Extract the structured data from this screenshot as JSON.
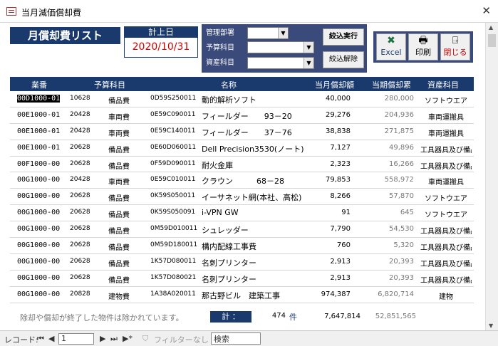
{
  "window": {
    "title": "当月減価償却費"
  },
  "header": {
    "list_title": "月償却費リスト",
    "date_label": "計上日",
    "date_value": "2020/10/31"
  },
  "filters": {
    "dept_label": "管理部署",
    "budget_label": "予算科目",
    "asset_label": "資産科目",
    "apply_label": "絞込実行",
    "clear_label": "絞込解除"
  },
  "actions": {
    "excel_label": "Excel",
    "print_label": "印刷",
    "close_label": "閉じる"
  },
  "columns": {
    "id": "業番",
    "budget": "予算科目",
    "name": "名称",
    "monthly_dep": "当月償却額",
    "cumulative": "当期償却累",
    "asset_category": "資産科目"
  },
  "rows": [
    {
      "id": "00D1000-01",
      "code": "10628",
      "budget": "備品費",
      "asset_no": "0D59S250011",
      "name": "動的解析ソフト",
      "dep": "40,000",
      "cum": "280,000",
      "cat": "ソフトウエア"
    },
    {
      "id": "00E1000-01",
      "code": "20428",
      "budget": "車両費",
      "asset_no": "0E59C090011",
      "name": "フィールダー　　93－20",
      "dep": "29,276",
      "cum": "204,936",
      "cat": "車両運搬具"
    },
    {
      "id": "00E1000-01",
      "code": "20428",
      "budget": "車両費",
      "asset_no": "0E59C140011",
      "name": "フィールダー　　37－76",
      "dep": "38,838",
      "cum": "271,875",
      "cat": "車両運搬具"
    },
    {
      "id": "00E1000-01",
      "code": "20628",
      "budget": "備品費",
      "asset_no": "0E60D060011",
      "name": "Dell Precision3530(ノート)",
      "dep": "7,127",
      "cum": "49,896",
      "cat": "工具器具及び備品"
    },
    {
      "id": "00F1000-00",
      "code": "20628",
      "budget": "備品費",
      "asset_no": "0F59D090011",
      "name": "耐火金庫",
      "dep": "2,323",
      "cum": "16,266",
      "cat": "工具器具及び備品"
    },
    {
      "id": "00G1000-00",
      "code": "20428",
      "budget": "車両費",
      "asset_no": "0E59C010011",
      "name": "クラウン　　　68－28",
      "dep": "79,853",
      "cum": "558,972",
      "cat": "車両運搬具"
    },
    {
      "id": "00G1000-00",
      "code": "20628",
      "budget": "備品費",
      "asset_no": "0K59S050011",
      "name": "イーサネット網(本社、高松)",
      "dep": "8,266",
      "cum": "57,870",
      "cat": "ソフトウエア"
    },
    {
      "id": "00G1000-00",
      "code": "20628",
      "budget": "備品費",
      "asset_no": "0K59S050091",
      "name": "i-VPN GW",
      "dep": "91",
      "cum": "645",
      "cat": "ソフトウエア"
    },
    {
      "id": "00G1000-00",
      "code": "20628",
      "budget": "備品費",
      "asset_no": "0M59D010011",
      "name": "シュレッダー",
      "dep": "7,790",
      "cum": "54,530",
      "cat": "工具器具及び備品"
    },
    {
      "id": "00G1000-00",
      "code": "20628",
      "budget": "備品費",
      "asset_no": "0M59D180011",
      "name": "構内配線工事費",
      "dep": "760",
      "cum": "5,320",
      "cat": "工具器具及び備品"
    },
    {
      "id": "00G1000-00",
      "code": "20628",
      "budget": "備品費",
      "asset_no": "1K57D080011",
      "name": "名刺プリンター",
      "dep": "2,913",
      "cum": "20,393",
      "cat": "工具器具及び備品"
    },
    {
      "id": "00G1000-00",
      "code": "20628",
      "budget": "備品費",
      "asset_no": "1K57D080021",
      "name": "名刺プリンター",
      "dep": "2,913",
      "cum": "20,393",
      "cat": "工具器具及び備品"
    },
    {
      "id": "00G1000-00",
      "code": "20828",
      "budget": "建物費",
      "asset_no": "1A38A020011",
      "name": "那古野ビル　建築工事",
      "dep": "974,387",
      "cum": "6,820,714",
      "cat": "建物"
    }
  ],
  "footer": {
    "note": "除却や償却が終了した物件は除かれています。",
    "total_label": "計 ：",
    "count": "474",
    "count_unit": "件",
    "total_dep": "7,647,814",
    "total_cum": "52,851,565"
  },
  "navbar": {
    "record_label": "レコード:",
    "current_record": "1",
    "filter_label": "フィルターなし",
    "search_label": "検索"
  }
}
